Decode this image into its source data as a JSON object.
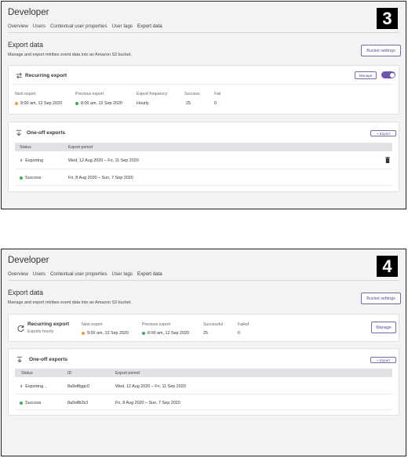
{
  "colors": {
    "accent": "#6f55b3",
    "dot_orange": "#f39a2e",
    "dot_green": "#3cae4e"
  },
  "screen3": {
    "badge": "3",
    "app_title": "Developer",
    "tabs": [
      "Overview",
      "Users",
      "Contextual user properties",
      "User tags",
      "Export data"
    ],
    "active_tab": "Export data",
    "section_title": "Export data",
    "section_desc": "Manage and export mtribes event data into an Amazon S3 bucket.",
    "bucket_button": "Bucket settings",
    "recurring": {
      "title": "Recurring export",
      "icon": "repeat-icon",
      "manage_button": "Manage",
      "toggle_on": true,
      "labels": {
        "next": "Next export",
        "previous": "Previous export",
        "frequency": "Export frequency",
        "success": "Success",
        "fail": "Fail"
      },
      "values": {
        "next": "9:00 am, 12 Sep 2020",
        "previous": "8:00 am, 12 Sep 2020",
        "frequency": "Hourly",
        "success": "25",
        "fail": "0"
      }
    },
    "oneoff": {
      "title": "One-off exports",
      "icon": "download-icon",
      "export_button": "+ Export",
      "headers": {
        "status": "Status",
        "period": "Export period"
      },
      "rows": [
        {
          "status": "Exporting",
          "status_icon": "exporting-icon",
          "period": "Wed, 12 Aug 2020 – Fri, 11 Sep 2020",
          "action_icon": "trash-icon"
        },
        {
          "status": "Success",
          "status_icon": "green-dot",
          "period": "Fri, 8 Aug 2020 – Sun, 7 Sep 2020"
        }
      ]
    }
  },
  "screen4": {
    "badge": "4",
    "app_title": "Developer",
    "tabs": [
      "Overview",
      "Users",
      "Contextual user properties",
      "User tags",
      "Export data"
    ],
    "active_tab": "Export data",
    "section_title": "Export data",
    "section_desc": "Manage and export mtribes event data into an Amazon S3 bucket.",
    "bucket_button": "Bucket settings",
    "recurring": {
      "title": "Recurring export",
      "subtitle": "Exports hourly",
      "icon": "refresh-icon",
      "manage_button": "Manage",
      "labels": {
        "next": "Next export",
        "previous": "Previous export",
        "successful": "Successful",
        "failed": "Failed"
      },
      "values": {
        "next": "9:00 am, 12 Sep 2020",
        "previous": "8:00 am, 12 Sep 2020",
        "successful": "25",
        "failed": "0"
      }
    },
    "oneoff": {
      "title": "One-off exports",
      "icon": "download-icon",
      "export_button": "+ Export",
      "headers": {
        "status": "Status",
        "id": "ID",
        "period": "Export period"
      },
      "rows": [
        {
          "status": "Exporting...",
          "status_icon": "exporting-icon",
          "id": "8a9sf8ggc0",
          "period": "Wed, 12 Aug 2020 – Fri, 11 Sep 2020"
        },
        {
          "status": "Success",
          "status_icon": "green-dot",
          "id": "8a9sf8i2k3",
          "period": "Fri, 8 Aug 2020 – Sun, 7 Sep 2020"
        }
      ]
    }
  }
}
